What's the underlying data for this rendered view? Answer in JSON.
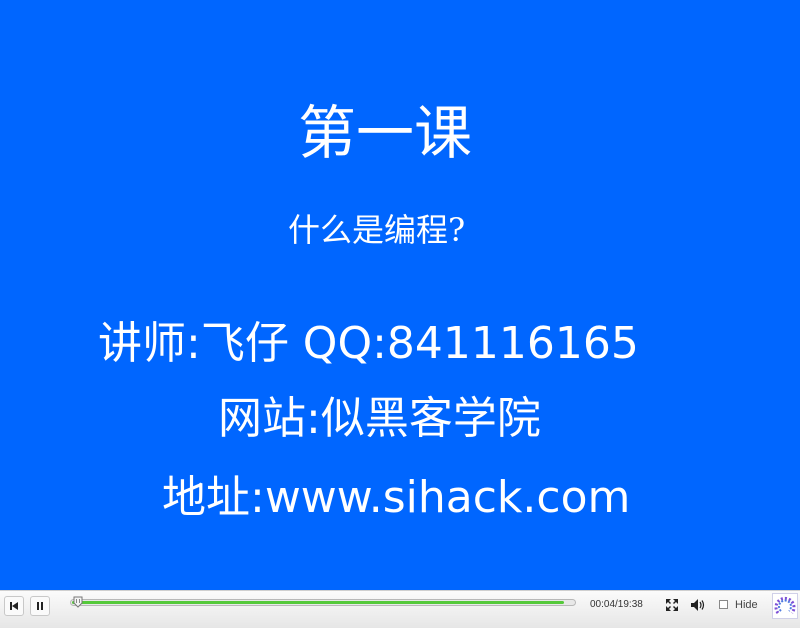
{
  "slide": {
    "title": "第一课",
    "subtitle": "什么是编程?",
    "instructor_line": "讲师:飞仔  QQ:841116165",
    "website_line": "网站:似黑客学院",
    "address_line": "地址:www.sihack.com",
    "background_color": "#0066ff"
  },
  "player": {
    "time": "00:04/19:38",
    "hide_label": "Hide",
    "progress_fraction": 0.98,
    "icons": [
      "rewind-icon",
      "pause-icon",
      "fullscreen-icon",
      "volume-icon",
      "logo-icon"
    ]
  }
}
